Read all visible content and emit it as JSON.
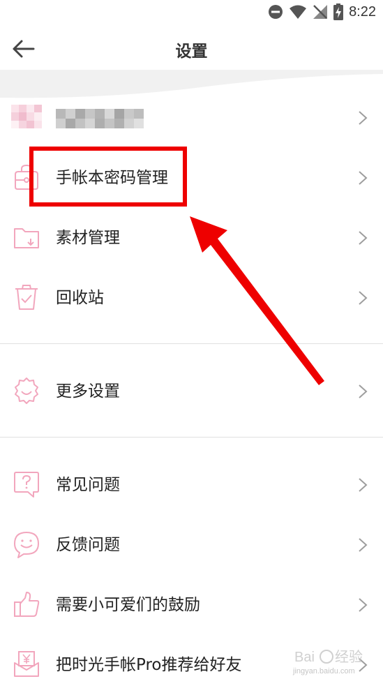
{
  "status_bar": {
    "time": "8:22"
  },
  "header": {
    "title": "设置"
  },
  "menu": {
    "group1": [
      {
        "label": "手帐本密码管理",
        "icon": "lock-bag-icon"
      },
      {
        "label": "素材管理",
        "icon": "folder-download-icon"
      },
      {
        "label": "回收站",
        "icon": "trash-check-icon"
      }
    ],
    "group2": [
      {
        "label": "更多设置",
        "icon": "gear-smile-icon"
      }
    ],
    "group3": [
      {
        "label": "常见问题",
        "icon": "question-bubble-icon"
      },
      {
        "label": "反馈问题",
        "icon": "smile-bubble-icon"
      },
      {
        "label": "需要小可爱们的鼓励",
        "icon": "thumbs-up-icon"
      },
      {
        "label": "把时光手帐Pro推荐给好友",
        "icon": "yen-envelope-icon"
      }
    ]
  },
  "watermark": {
    "text": "jingyan.baidu.com"
  },
  "colors": {
    "icon_pink": "#f2a6bd",
    "annotation_red": "#ee0000",
    "chevron": "#9e9e9e"
  }
}
